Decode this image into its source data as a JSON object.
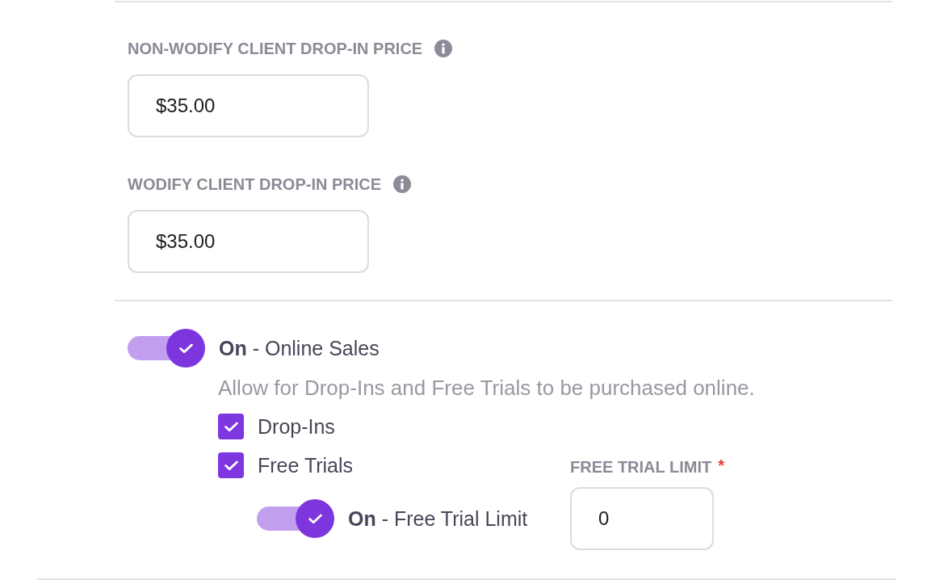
{
  "price_fields": [
    {
      "label": "NON-WODIFY CLIENT DROP-IN PRICE",
      "info": true,
      "value": "$35.00"
    },
    {
      "label": "WODIFY CLIENT DROP-IN PRICE",
      "info": true,
      "value": "$35.00"
    }
  ],
  "online_sales": {
    "toggle": {
      "on": true,
      "label": "**On** - Online Sales"
    },
    "description": "Allow for Drop-Ins and Free Trials to be purchased online.",
    "options": [
      {
        "label": "Drop-Ins",
        "checked": true
      },
      {
        "label": "Free Trials",
        "checked": true
      }
    ],
    "free_trial_limit_toggle": {
      "on": true,
      "label": "**On** - Free Trial Limit"
    },
    "free_trial_limit": {
      "label": "FREE TRIAL LIMIT",
      "required_mark": "*",
      "value": "0"
    }
  }
}
